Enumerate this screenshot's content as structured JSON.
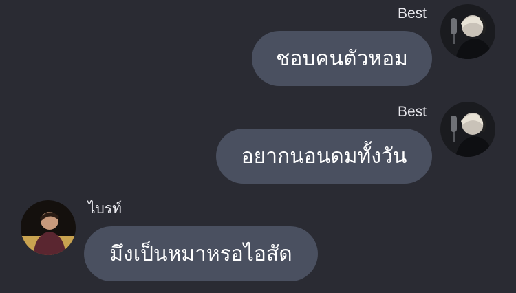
{
  "messages": [
    {
      "sender": "Best",
      "text": "ชอบคนตัวหอม",
      "side": "right",
      "avatar_icon": "person-headphones-icon"
    },
    {
      "sender": "Best",
      "text": "อยากนอนดมทั้งวัน",
      "side": "right",
      "avatar_icon": "person-headphones-icon"
    },
    {
      "sender": "ไบรท์",
      "text": "มึงเป็นหมาหรอไอสัด",
      "side": "left",
      "avatar_icon": "person-icon"
    }
  ],
  "colors": {
    "background": "#2a2b33",
    "bubble": "#4a5060",
    "text": "#ffffff"
  }
}
